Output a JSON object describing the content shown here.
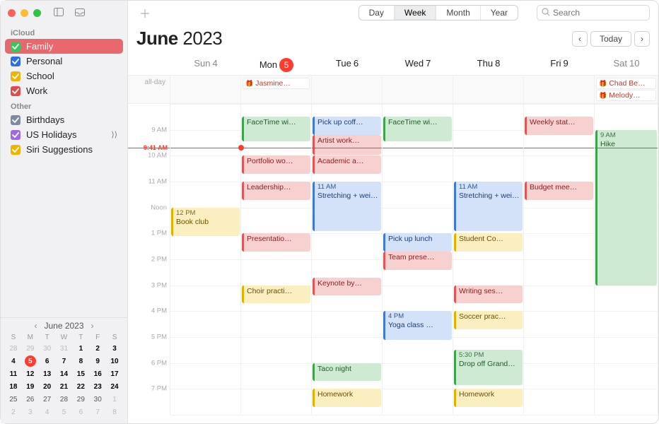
{
  "window": {
    "searchPlaceholder": "Search"
  },
  "views": {
    "items": [
      "Day",
      "Week",
      "Month",
      "Year"
    ],
    "active": 1
  },
  "nav": {
    "prev": "‹",
    "today": "Today",
    "next": "›"
  },
  "header": {
    "monthBold": "June",
    "year": "2023"
  },
  "sidebar": {
    "groups": [
      {
        "label": "iCloud",
        "items": [
          {
            "name": "Family",
            "color": "#32c85a",
            "checked": true,
            "selected": true
          },
          {
            "name": "Personal",
            "color": "#2e6fe0",
            "checked": true
          },
          {
            "name": "School",
            "color": "#f0b400",
            "checked": true
          },
          {
            "name": "Work",
            "color": "#e24b4b",
            "checked": true
          }
        ]
      },
      {
        "label": "Other",
        "items": [
          {
            "name": "Birthdays",
            "color": "#7d8aa0",
            "checked": true
          },
          {
            "name": "US Holidays",
            "color": "#a069e0",
            "checked": true,
            "shared": true
          },
          {
            "name": "Siri Suggestions",
            "color": "#f0b400",
            "checked": true
          }
        ]
      }
    ]
  },
  "mini": {
    "title": "June 2023",
    "dows": [
      "S",
      "M",
      "T",
      "W",
      "T",
      "F",
      "S"
    ],
    "weeks": [
      [
        {
          "n": 28,
          "o": true
        },
        {
          "n": 29,
          "o": true
        },
        {
          "n": 30,
          "o": true
        },
        {
          "n": 31,
          "o": true
        },
        {
          "n": 1,
          "b": true
        },
        {
          "n": 2,
          "b": true
        },
        {
          "n": 3,
          "b": true
        }
      ],
      [
        {
          "n": 4,
          "b": true
        },
        {
          "n": 5,
          "today": true
        },
        {
          "n": 6,
          "b": true
        },
        {
          "n": 7,
          "b": true
        },
        {
          "n": 8,
          "b": true
        },
        {
          "n": 9,
          "b": true
        },
        {
          "n": 10,
          "b": true
        }
      ],
      [
        {
          "n": 11,
          "b": true
        },
        {
          "n": 12,
          "b": true
        },
        {
          "n": 13,
          "b": true
        },
        {
          "n": 14,
          "b": true
        },
        {
          "n": 15,
          "b": true
        },
        {
          "n": 16,
          "b": true
        },
        {
          "n": 17,
          "b": true
        }
      ],
      [
        {
          "n": 18,
          "b": true
        },
        {
          "n": 19,
          "b": true
        },
        {
          "n": 20,
          "b": true
        },
        {
          "n": 21,
          "b": true
        },
        {
          "n": 22,
          "b": true
        },
        {
          "n": 23,
          "b": true
        },
        {
          "n": 24,
          "b": true
        }
      ],
      [
        {
          "n": 25
        },
        {
          "n": 26
        },
        {
          "n": 27
        },
        {
          "n": 28
        },
        {
          "n": 29
        },
        {
          "n": 30
        },
        {
          "n": 1,
          "o": true
        }
      ],
      [
        {
          "n": 2,
          "o": true
        },
        {
          "n": 3,
          "o": true
        },
        {
          "n": 4,
          "o": true
        },
        {
          "n": 5,
          "o": true
        },
        {
          "n": 6,
          "o": true
        },
        {
          "n": 7,
          "o": true
        },
        {
          "n": 8,
          "o": true
        }
      ]
    ]
  },
  "week": {
    "alldayLabel": "all-day",
    "gridStartHour": 8,
    "gridEndHour": 20,
    "hours": [
      "9 AM",
      "10 AM",
      "11 AM",
      "Noon",
      "1 PM",
      "2 PM",
      "3 PM",
      "4 PM",
      "5 PM",
      "6 PM",
      "7 PM"
    ],
    "hoursAt": [
      9,
      10,
      11,
      12,
      13,
      14,
      15,
      16,
      17,
      18,
      19
    ],
    "nowLabel": "9:41 AM",
    "nowHour": 9.683,
    "days": [
      {
        "label": "Sun",
        "num": "4"
      },
      {
        "label": "Mon",
        "num": "5",
        "today": true
      },
      {
        "label": "Tue",
        "num": "6"
      },
      {
        "label": "Wed",
        "num": "7"
      },
      {
        "label": "Thu",
        "num": "8"
      },
      {
        "label": "Fri",
        "num": "9"
      },
      {
        "label": "Sat",
        "num": "10"
      }
    ],
    "allday": {
      "1": [
        {
          "title": "Jasmine…",
          "cal": "birthday"
        }
      ],
      "6": [
        {
          "title": "Chad Be…",
          "cal": "birthday"
        },
        {
          "title": "Melody…",
          "cal": "birthday"
        }
      ]
    },
    "events": {
      "0": [
        {
          "start": 12,
          "end": 13.1,
          "cal": "yellow",
          "time": "12 PM",
          "title": "Book club"
        }
      ],
      "1": [
        {
          "start": 8.5,
          "end": 9.45,
          "cal": "green",
          "title": "FaceTime wi…"
        },
        {
          "start": 10,
          "end": 10.7,
          "cal": "red",
          "title": "Portfolio wo…"
        },
        {
          "start": 11,
          "end": 11.7,
          "cal": "red",
          "title": "Leadership…"
        },
        {
          "start": 13,
          "end": 13.7,
          "cal": "red",
          "title": "Presentatio…"
        },
        {
          "start": 15,
          "end": 15.7,
          "cal": "yellow",
          "title": "Choir practi…"
        }
      ],
      "2": [
        {
          "start": 8.5,
          "end": 9.2,
          "cal": "blue",
          "title": "Pick up coff…"
        },
        {
          "start": 9.2,
          "end": 9.95,
          "cal": "red",
          "title": "Artist work…"
        },
        {
          "start": 10,
          "end": 10.7,
          "cal": "red",
          "title": "Academic a…"
        },
        {
          "start": 11,
          "end": 12.9,
          "cal": "blue",
          "time": "11 AM",
          "title": "Stretching + weights"
        },
        {
          "start": 14.7,
          "end": 15.4,
          "cal": "red",
          "title": "Keynote by…"
        },
        {
          "start": 18,
          "end": 18.7,
          "cal": "green",
          "title": "Taco night"
        },
        {
          "start": 19,
          "end": 19.7,
          "cal": "yellow",
          "title": "Homework"
        }
      ],
      "3": [
        {
          "start": 8.5,
          "end": 9.45,
          "cal": "green",
          "title": "FaceTime wi…"
        },
        {
          "start": 13,
          "end": 13.7,
          "cal": "blue",
          "title": "Pick up lunch"
        },
        {
          "start": 13.7,
          "end": 14.4,
          "cal": "red",
          "title": "Team prese…"
        },
        {
          "start": 16,
          "end": 17.1,
          "cal": "blue",
          "time": "4 PM",
          "title": "Yoga class  …"
        }
      ],
      "4": [
        {
          "start": 11,
          "end": 12.9,
          "cal": "blue",
          "time": "11 AM",
          "title": "Stretching + weights"
        },
        {
          "start": 13,
          "end": 13.7,
          "cal": "yellow",
          "title": "Student Co…"
        },
        {
          "start": 15,
          "end": 15.7,
          "cal": "red",
          "title": "Writing ses…"
        },
        {
          "start": 16,
          "end": 16.7,
          "cal": "yellow",
          "title": "Soccer prac…"
        },
        {
          "start": 17.5,
          "end": 18.85,
          "cal": "green",
          "time": "5:30 PM",
          "title": "Drop off Grandma…"
        },
        {
          "start": 19,
          "end": 19.7,
          "cal": "yellow",
          "title": "Homework"
        }
      ],
      "5": [
        {
          "start": 8.5,
          "end": 9.2,
          "cal": "red",
          "title": "Weekly stat…"
        },
        {
          "start": 11,
          "end": 11.7,
          "cal": "red",
          "title": "Budget mee…"
        }
      ],
      "6": [
        {
          "start": 9,
          "end": 15,
          "cal": "green",
          "time": "9 AM",
          "title": "Hike"
        }
      ]
    }
  }
}
